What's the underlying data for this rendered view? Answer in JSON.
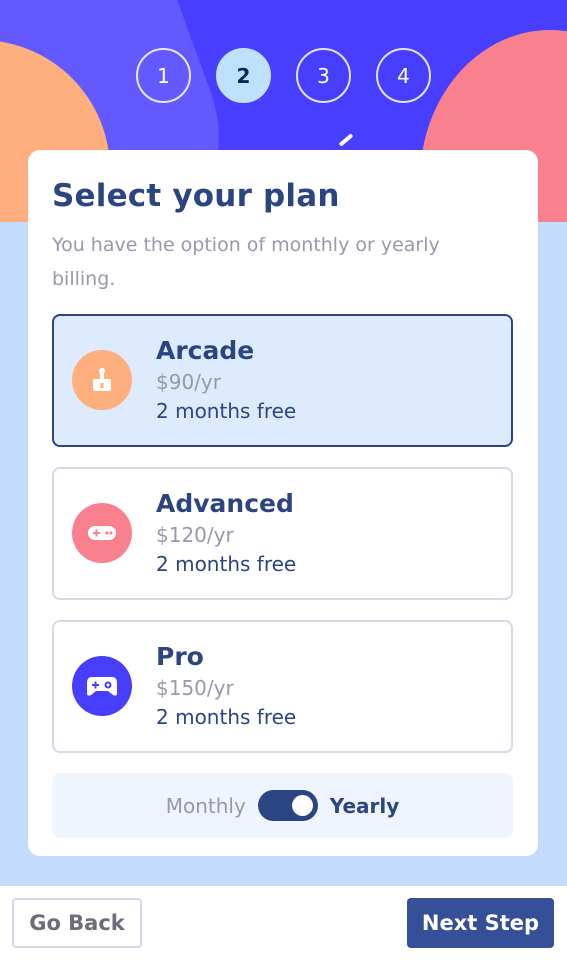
{
  "steps": [
    "1",
    "2",
    "3",
    "4"
  ],
  "active_step": "2",
  "form": {
    "title": "Select your plan",
    "subtitle": "You have the option of monthly or yearly billing."
  },
  "plans": [
    {
      "name": "Arcade",
      "price": "$90/yr",
      "promo": "2 months free",
      "icon": "joystick-icon",
      "icon_color": "#ffaf7e",
      "selected": true
    },
    {
      "name": "Advanced",
      "price": "$120/yr",
      "promo": "2 months free",
      "icon": "gamepad-icon",
      "icon_color": "#f9818e",
      "selected": false
    },
    {
      "name": "Pro",
      "price": "$150/yr",
      "promo": "2 months free",
      "icon": "controller-icon",
      "icon_color": "#483eff",
      "selected": false
    }
  ],
  "billing": {
    "monthly_label": "Monthly",
    "yearly_label": "Yearly",
    "selected": "Yearly"
  },
  "footer": {
    "back_label": "Go Back",
    "next_label": "Next Step"
  },
  "colors": {
    "primary_dark": "#2b4583",
    "accent": "#483eff",
    "selected_bg": "#deeafd",
    "page_bg": "#c3dcfd"
  }
}
